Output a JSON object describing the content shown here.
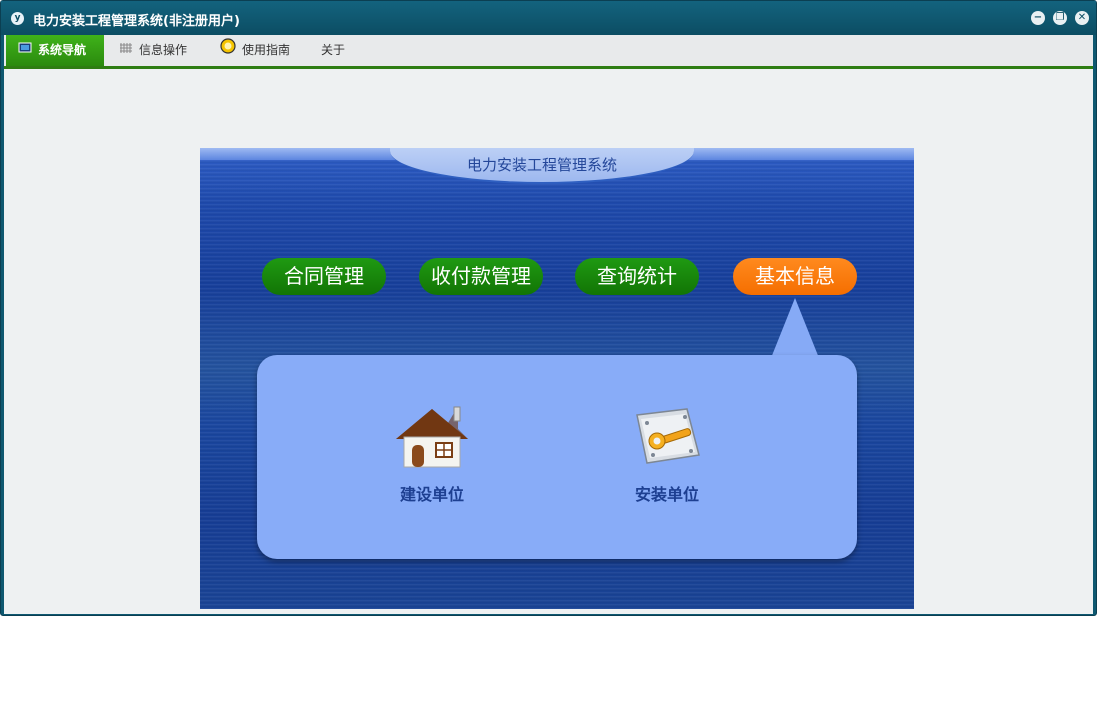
{
  "window": {
    "title": "电力安装工程管理系统(非注册用户)",
    "app_icon_text": "y",
    "controls": {
      "minimize": "−",
      "restore": "❐",
      "close": "✕"
    }
  },
  "menu": {
    "items": [
      {
        "label": "系统导航",
        "icon": "monitor-icon",
        "active": true
      },
      {
        "label": "信息操作",
        "icon": "grid-icon",
        "active": false
      },
      {
        "label": "使用指南",
        "icon": "help-icon",
        "active": false
      },
      {
        "label": "关于",
        "icon": "",
        "active": false
      }
    ]
  },
  "panel": {
    "title": "电力安装工程管理系统",
    "nav": [
      {
        "label": "合同管理",
        "color": "green"
      },
      {
        "label": "收付款管理",
        "color": "green"
      },
      {
        "label": "查询统计",
        "color": "green"
      },
      {
        "label": "基本信息",
        "color": "orange",
        "active": true
      }
    ],
    "tiles": [
      {
        "label": "建设单位",
        "icon": "house-icon"
      },
      {
        "label": "安装单位",
        "icon": "wrench-settings-icon"
      }
    ]
  },
  "colors": {
    "title_bar": "#0e5870",
    "menu_active": "#2e9a14",
    "nav_green": "#1a8a0c",
    "nav_orange": "#f5760a",
    "bubble": "#88acf8"
  }
}
